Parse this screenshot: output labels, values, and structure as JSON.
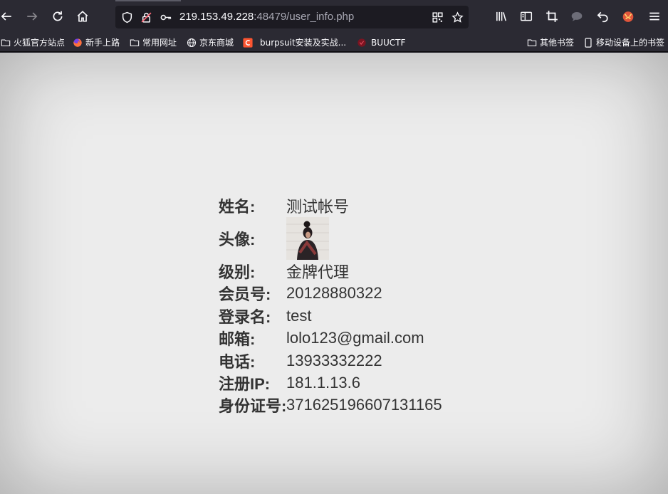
{
  "browser": {
    "url_host": "219.153.49.228",
    "url_rest": ":48479/user_info.php"
  },
  "bookmarks": [
    {
      "label": "火狐官方站点",
      "icon": "folder-icon"
    },
    {
      "label": "新手上路",
      "icon": "firefox-icon"
    },
    {
      "label": "常用网址",
      "icon": "folder-icon"
    },
    {
      "label": "京东商城",
      "icon": "globe-icon"
    },
    {
      "label": "burpsuit安装及实战...",
      "icon": "csdn-icon"
    },
    {
      "label": "BUUCTF",
      "icon": "buuctf-icon"
    },
    {
      "label": "其他书签",
      "icon": "folder-icon"
    },
    {
      "label": "移动设备上的书签",
      "icon": "mobile-icon"
    }
  ],
  "user_info": {
    "name_label": "姓名:",
    "name": "测试帐号",
    "avatar_label": "头像:",
    "level_label": "级别:",
    "level": "金牌代理",
    "member_label": "会员号:",
    "member_no": "20128880322",
    "login_label": "登录名:",
    "login": "test",
    "email_label": "邮箱:",
    "email": "lolo123@gmail.com",
    "phone_label": "电话:",
    "phone": "13933332222",
    "ip_label": "注册IP:",
    "ip": "181.1.13.6",
    "id_label": "身份证号:",
    "id_no": "371625196607131165"
  },
  "colors": {
    "toolbar": "#2b2a33",
    "urlbar": "#1c1b22",
    "page_bg": "#ececec",
    "text": "#333333"
  }
}
